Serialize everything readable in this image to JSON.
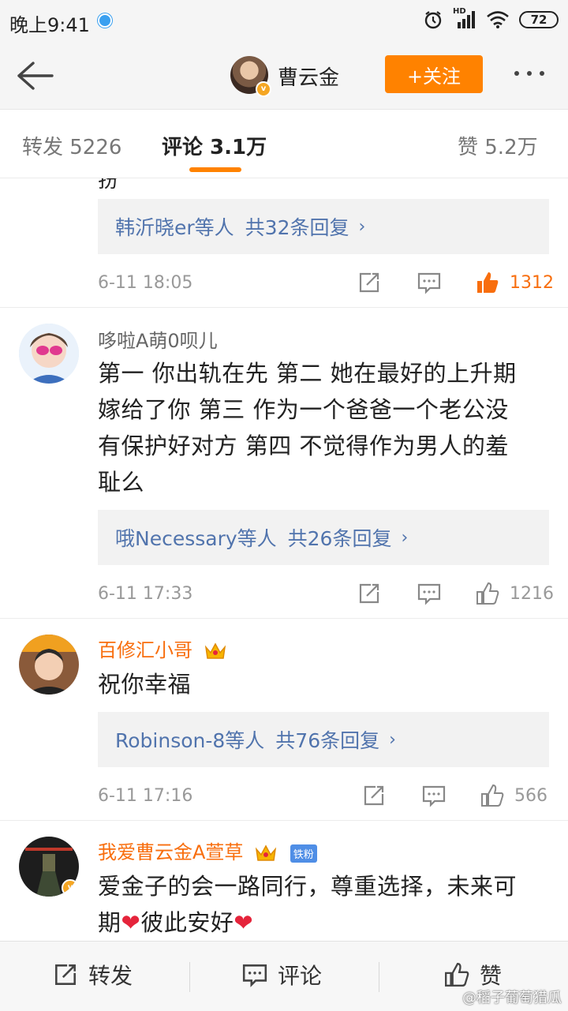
{
  "status": {
    "time": "晚上9:41",
    "battery": "72",
    "network_label": "HD"
  },
  "nav": {
    "name": "曹云金",
    "follow_label": "+关注"
  },
  "tabs": [
    {
      "label": "转发 5226",
      "active": false
    },
    {
      "label": "评论 3.1万",
      "active": true
    },
    {
      "label": "赞 5.2万",
      "active": false
    }
  ],
  "comments": [
    {
      "truncated_char": "扮",
      "replies": {
        "users": "韩沂晓er等人",
        "total": "共32条回复"
      },
      "time": "6-11 18:05",
      "likes": "1312",
      "liked": true
    },
    {
      "author": "哆啦A萌0呗儿",
      "text_lines": [
        "第一 你出轨在先 第二 她在最好的上升期",
        "嫁给了你 第三 作为一个爸爸一个老公没",
        "有保护好对方 第四 不觉得作为男人的羞",
        "耻么"
      ],
      "replies": {
        "users": "哦Necessary等人",
        "total": "共26条回复"
      },
      "time": "6-11 17:33",
      "likes": "1216"
    },
    {
      "author": "百修汇小哥",
      "text": "祝你幸福",
      "replies": {
        "users": "Robinson-8等人",
        "total": "共76条回复"
      },
      "time": "6-11 17:16",
      "likes": "566"
    },
    {
      "author": "我爱曹云金A萱草",
      "badge": "铁粉",
      "text_line1": "爱金子的会一路同行，尊重选择，未来可",
      "text_line2a": "期",
      "text_line2b": "彼此安好"
    }
  ],
  "bottom": {
    "repost": "转发",
    "comment": "评论",
    "like": "赞"
  },
  "watermark": "@稻子葡萄猎瓜",
  "colors": {
    "accent": "#ff8200",
    "link": "#5174ad",
    "vip_name": "#f86e0e",
    "liked": "#f86e0e"
  }
}
